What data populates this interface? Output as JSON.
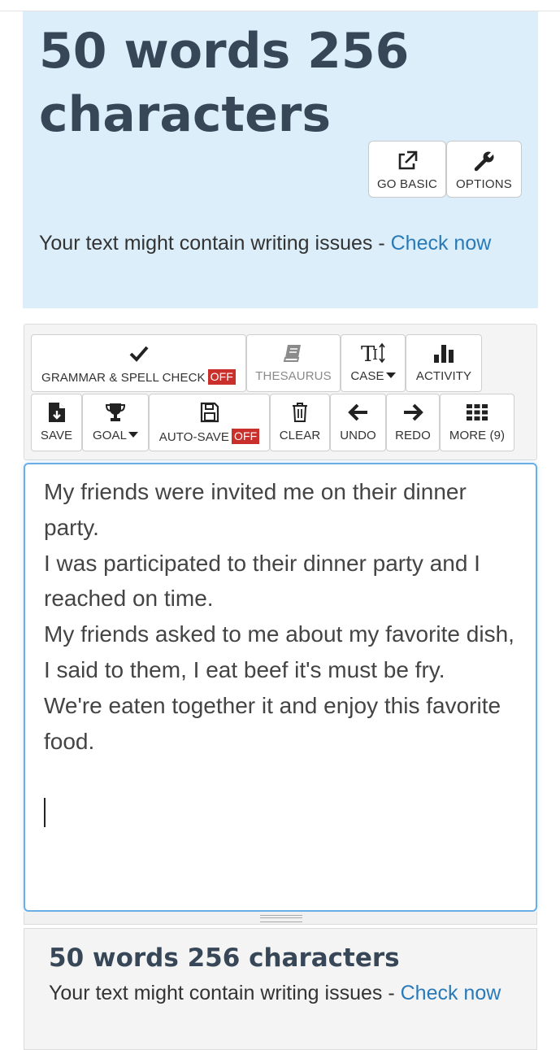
{
  "header": {
    "count_title": "50 words 256 characters",
    "go_basic_label": "GO BASIC",
    "options_label": "OPTIONS",
    "issues_text": "Your text might contain writing issues - ",
    "check_now_label": "Check now"
  },
  "toolbar": {
    "grammar_label": "GRAMMAR & SPELL CHECK",
    "grammar_state": "OFF",
    "thesaurus_label": "THESAURUS",
    "case_label": "CASE",
    "activity_label": "ACTIVITY",
    "save_label": "SAVE",
    "goal_label": "GOAL",
    "autosave_label": "AUTO-SAVE",
    "autosave_state": "OFF",
    "clear_label": "CLEAR",
    "undo_label": "UNDO",
    "redo_label": "REDO",
    "more_label": "MORE (9)"
  },
  "editor": {
    "text": "My friends were invited me on their dinner party.\nI was participated to their dinner party and I reached on time.\nMy friends asked to me about my favorite dish, I said to them, I eat beef it's must be fry.\nWe're eaten together it and enjoy this favorite food."
  },
  "footer": {
    "count_title": "50 words 256 characters",
    "issues_text": "Your text might contain writing issues - ",
    "check_now_label": "Check now"
  },
  "colors": {
    "header_bg": "#dbeef9",
    "title_color": "#374758",
    "link_color": "#2a7ab8",
    "off_badge": "#c9302c",
    "editor_border": "#6aaee5"
  },
  "icons": [
    "external-link-icon",
    "wrench-icon",
    "checkmark-icon",
    "book-icon",
    "text-case-icon",
    "bar-chart-icon",
    "save-file-icon",
    "trophy-icon",
    "floppy-disk-icon",
    "trash-icon",
    "arrow-left-icon",
    "arrow-right-icon",
    "grid-icon"
  ]
}
